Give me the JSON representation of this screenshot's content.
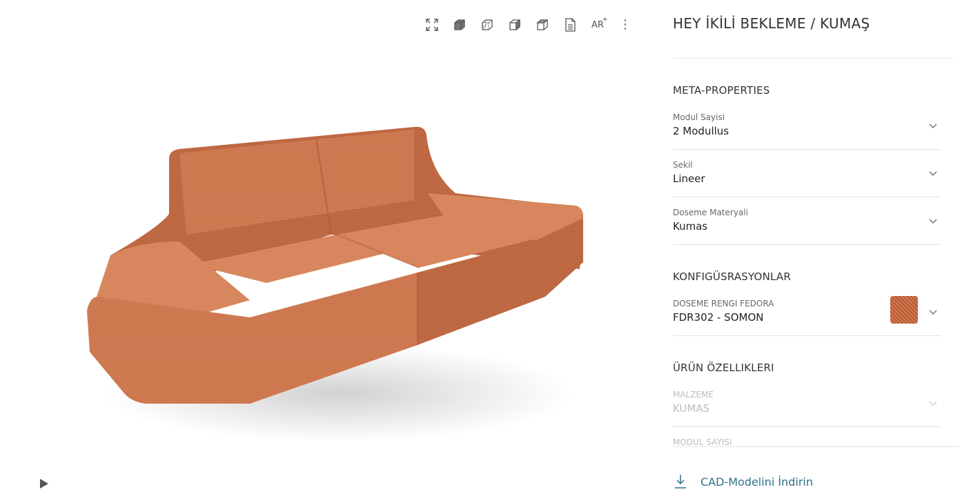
{
  "toolbar": {
    "icons": [
      "fullscreen-icon",
      "view-cube-solid-icon",
      "view-cube-wire-icon",
      "view-cube-front-icon",
      "view-cube-side-icon",
      "document-icon",
      "ar-icon",
      "more-vertical-icon"
    ],
    "ar_label": "AR"
  },
  "viewer": {
    "sofa_color": "#D07A52",
    "play_icon": "play-icon"
  },
  "product": {
    "title": "HEY İKİLİ BEKLEME / KUMAŞ"
  },
  "meta": {
    "heading": "META-PROPERTIES",
    "items": [
      {
        "label": "Modul Sayisi",
        "value": "2 Modullus"
      },
      {
        "label": "Sekil",
        "value": "Lineer"
      },
      {
        "label": "Doseme Materyali",
        "value": "Kumas"
      }
    ]
  },
  "config": {
    "heading": "KONFIGÜSRASYONLAR",
    "items": [
      {
        "label": "DOSEME RENGI FEDORA",
        "value": "FDR302 - SOMON",
        "swatch_color": "#C86A42"
      }
    ]
  },
  "features": {
    "heading": "ÜRÜN ÖZELLIKLERI",
    "items": [
      {
        "label": "MALZEME",
        "value": "KUMAS"
      },
      {
        "label": "MODUL SAYISI",
        "value": ""
      }
    ]
  },
  "cad": {
    "label": "CAD-Modelini İndirin",
    "icon": "download-icon",
    "color": "#2F6F8A"
  }
}
